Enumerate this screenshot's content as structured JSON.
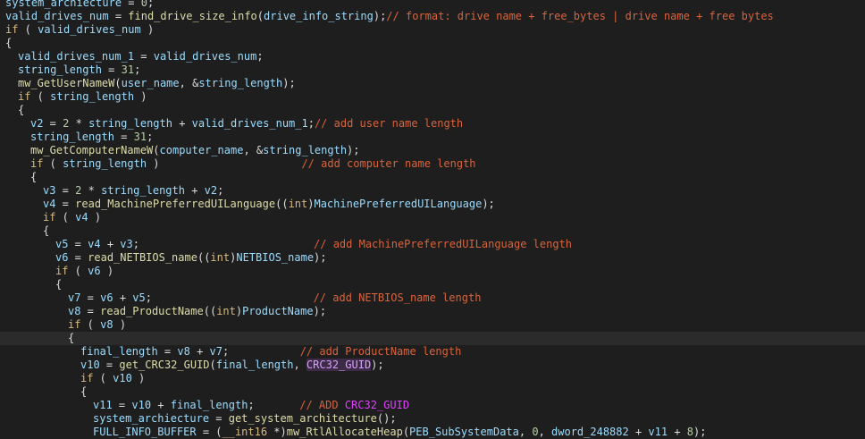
{
  "editor": {
    "colors": {
      "background": "#1e1e1e",
      "identifier": "#9cdcfe",
      "function": "#dcdcaa",
      "keyword": "#d7ba7d",
      "comment": "#d8643c",
      "highlight_symbol": "#d7a0ff",
      "highlight_background": "#3d2a46",
      "current_line": "#2b2b2b"
    },
    "lines": [
      {
        "indent": 0,
        "tokens": [
          [
            "ident",
            "system_archiecture"
          ],
          [
            "punct",
            " = "
          ],
          [
            "num",
            "0"
          ],
          [
            "punct",
            ";"
          ]
        ]
      },
      {
        "indent": 0,
        "tokens": [
          [
            "ident",
            "valid_drives_num"
          ],
          [
            "punct",
            " = "
          ],
          [
            "func",
            "find_drive_size_info"
          ],
          [
            "punct",
            "("
          ],
          [
            "ident",
            "drive_info_string"
          ],
          [
            "punct",
            ");"
          ],
          [
            "comment",
            "// format: drive name + free_bytes | drive name + free bytes"
          ]
        ]
      },
      {
        "indent": 0,
        "tokens": [
          [
            "kw",
            "if"
          ],
          [
            "punct",
            " ( "
          ],
          [
            "ident",
            "valid_drives_num"
          ],
          [
            "punct",
            " )"
          ]
        ]
      },
      {
        "indent": 0,
        "tokens": [
          [
            "punct",
            "{"
          ]
        ]
      },
      {
        "indent": 2,
        "tokens": [
          [
            "ident",
            "valid_drives_num_1"
          ],
          [
            "punct",
            " = "
          ],
          [
            "ident",
            "valid_drives_num"
          ],
          [
            "punct",
            ";"
          ]
        ]
      },
      {
        "indent": 2,
        "tokens": [
          [
            "ident",
            "string_length"
          ],
          [
            "punct",
            " = "
          ],
          [
            "num",
            "31"
          ],
          [
            "punct",
            ";"
          ]
        ]
      },
      {
        "indent": 2,
        "tokens": [
          [
            "func",
            "mw_GetUserNameW"
          ],
          [
            "punct",
            "("
          ],
          [
            "ident",
            "user_name"
          ],
          [
            "punct",
            ", &"
          ],
          [
            "ident",
            "string_length"
          ],
          [
            "punct",
            ");"
          ]
        ]
      },
      {
        "indent": 2,
        "tokens": [
          [
            "kw",
            "if"
          ],
          [
            "punct",
            " ( "
          ],
          [
            "ident",
            "string_length"
          ],
          [
            "punct",
            " )"
          ]
        ]
      },
      {
        "indent": 2,
        "tokens": [
          [
            "punct",
            "{"
          ]
        ]
      },
      {
        "indent": 4,
        "tokens": [
          [
            "ident",
            "v2"
          ],
          [
            "punct",
            " = "
          ],
          [
            "num",
            "2"
          ],
          [
            "punct",
            " * "
          ],
          [
            "ident",
            "string_length"
          ],
          [
            "punct",
            " + "
          ],
          [
            "ident",
            "valid_drives_num_1"
          ],
          [
            "punct",
            ";"
          ],
          [
            "comment",
            "// add user name length"
          ]
        ]
      },
      {
        "indent": 4,
        "tokens": [
          [
            "ident",
            "string_length"
          ],
          [
            "punct",
            " = "
          ],
          [
            "num",
            "31"
          ],
          [
            "punct",
            ";"
          ]
        ]
      },
      {
        "indent": 4,
        "tokens": [
          [
            "func",
            "mw_GetComputerNameW"
          ],
          [
            "punct",
            "("
          ],
          [
            "ident",
            "computer_name"
          ],
          [
            "punct",
            ", &"
          ],
          [
            "ident",
            "string_length"
          ],
          [
            "punct",
            ");"
          ]
        ]
      },
      {
        "indent": 4,
        "tokens": [
          [
            "kw",
            "if"
          ],
          [
            "punct",
            " ( "
          ],
          [
            "ident",
            "string_length"
          ],
          [
            "punct",
            " )                      "
          ],
          [
            "comment",
            "// add computer name length"
          ]
        ]
      },
      {
        "indent": 4,
        "tokens": [
          [
            "punct",
            "{"
          ]
        ]
      },
      {
        "indent": 6,
        "tokens": [
          [
            "ident",
            "v3"
          ],
          [
            "punct",
            " = "
          ],
          [
            "num",
            "2"
          ],
          [
            "punct",
            " * "
          ],
          [
            "ident",
            "string_length"
          ],
          [
            "punct",
            " + "
          ],
          [
            "ident",
            "v2"
          ],
          [
            "punct",
            ";"
          ]
        ]
      },
      {
        "indent": 6,
        "tokens": [
          [
            "ident",
            "v4"
          ],
          [
            "punct",
            " = "
          ],
          [
            "func",
            "read_MachinePreferredUILanguage"
          ],
          [
            "punct",
            "(("
          ],
          [
            "kw",
            "int"
          ],
          [
            "punct",
            ")"
          ],
          [
            "ident",
            "MachinePreferredUILanguage"
          ],
          [
            "punct",
            ");"
          ]
        ]
      },
      {
        "indent": 6,
        "tokens": [
          [
            "kw",
            "if"
          ],
          [
            "punct",
            " ( "
          ],
          [
            "ident",
            "v4"
          ],
          [
            "punct",
            " )"
          ]
        ]
      },
      {
        "indent": 6,
        "tokens": [
          [
            "punct",
            "{"
          ]
        ]
      },
      {
        "indent": 8,
        "tokens": [
          [
            "ident",
            "v5"
          ],
          [
            "punct",
            " = "
          ],
          [
            "ident",
            "v4"
          ],
          [
            "punct",
            " + "
          ],
          [
            "ident",
            "v3"
          ],
          [
            "punct",
            ";                           "
          ],
          [
            "comment",
            "// add MachinePreferredUILanguage length"
          ]
        ]
      },
      {
        "indent": 8,
        "tokens": [
          [
            "ident",
            "v6"
          ],
          [
            "punct",
            " = "
          ],
          [
            "func",
            "read_NETBIOS_name"
          ],
          [
            "punct",
            "(("
          ],
          [
            "kw",
            "int"
          ],
          [
            "punct",
            ")"
          ],
          [
            "ident",
            "NETBIOS_name"
          ],
          [
            "punct",
            ");"
          ]
        ]
      },
      {
        "indent": 8,
        "tokens": [
          [
            "kw",
            "if"
          ],
          [
            "punct",
            " ( "
          ],
          [
            "ident",
            "v6"
          ],
          [
            "punct",
            " )"
          ]
        ]
      },
      {
        "indent": 8,
        "tokens": [
          [
            "punct",
            "{"
          ]
        ]
      },
      {
        "indent": 10,
        "tokens": [
          [
            "ident",
            "v7"
          ],
          [
            "punct",
            " = "
          ],
          [
            "ident",
            "v6"
          ],
          [
            "punct",
            " + "
          ],
          [
            "ident",
            "v5"
          ],
          [
            "punct",
            ";                         "
          ],
          [
            "comment",
            "// add NETBIOS_name length"
          ]
        ]
      },
      {
        "indent": 10,
        "tokens": [
          [
            "ident",
            "v8"
          ],
          [
            "punct",
            " = "
          ],
          [
            "func",
            "read_ProductName"
          ],
          [
            "punct",
            "(("
          ],
          [
            "kw",
            "int"
          ],
          [
            "punct",
            ")"
          ],
          [
            "ident",
            "ProductName"
          ],
          [
            "punct",
            ");"
          ]
        ]
      },
      {
        "indent": 10,
        "tokens": [
          [
            "kw",
            "if"
          ],
          [
            "punct",
            " ( "
          ],
          [
            "ident",
            "v8"
          ],
          [
            "punct",
            " )"
          ]
        ]
      },
      {
        "indent": 10,
        "highlight": true,
        "tokens": [
          [
            "punct",
            "{"
          ]
        ]
      },
      {
        "indent": 12,
        "tokens": [
          [
            "ident",
            "final_length"
          ],
          [
            "punct",
            " = "
          ],
          [
            "ident",
            "v8"
          ],
          [
            "punct",
            " + "
          ],
          [
            "ident",
            "v7"
          ],
          [
            "punct",
            ";           "
          ],
          [
            "comment",
            "// add ProductName length"
          ]
        ]
      },
      {
        "indent": 12,
        "tokens": [
          [
            "ident",
            "v10"
          ],
          [
            "punct",
            " = "
          ],
          [
            "func",
            "get_CRC32_GUID"
          ],
          [
            "punct",
            "("
          ],
          [
            "ident",
            "final_length"
          ],
          [
            "punct",
            ", "
          ],
          [
            "hl",
            "CRC32_GUID"
          ],
          [
            "punct",
            ");"
          ]
        ]
      },
      {
        "indent": 12,
        "tokens": [
          [
            "kw",
            "if"
          ],
          [
            "punct",
            " ( "
          ],
          [
            "ident",
            "v10"
          ],
          [
            "punct",
            " )"
          ]
        ]
      },
      {
        "indent": 12,
        "tokens": [
          [
            "punct",
            "{"
          ]
        ]
      },
      {
        "indent": 14,
        "tokens": [
          [
            "ident",
            "v11"
          ],
          [
            "punct",
            " = "
          ],
          [
            "ident",
            "v10"
          ],
          [
            "punct",
            " + "
          ],
          [
            "ident",
            "final_length"
          ],
          [
            "punct",
            ";       "
          ],
          [
            "comment",
            "// ADD "
          ],
          [
            "commenthl",
            "CRC32_GUID"
          ]
        ]
      },
      {
        "indent": 14,
        "tokens": [
          [
            "ident",
            "system_archiecture"
          ],
          [
            "punct",
            " = "
          ],
          [
            "func",
            "get_system_architecture"
          ],
          [
            "punct",
            "();"
          ]
        ]
      },
      {
        "indent": 14,
        "tokens": [
          [
            "ident",
            "FULL_INFO_BUFFER"
          ],
          [
            "punct",
            " = ("
          ],
          [
            "kw",
            "__int16"
          ],
          [
            "punct",
            " *)"
          ],
          [
            "func",
            "mw_RtlAllocateHeap"
          ],
          [
            "punct",
            "("
          ],
          [
            "ident",
            "PEB_SubSystemData"
          ],
          [
            "punct",
            ", "
          ],
          [
            "num",
            "0"
          ],
          [
            "punct",
            ", "
          ],
          [
            "ident",
            "dword_248882"
          ],
          [
            "punct",
            " + "
          ],
          [
            "ident",
            "v11"
          ],
          [
            "punct",
            " + "
          ],
          [
            "num",
            "8"
          ],
          [
            "punct",
            ");"
          ]
        ]
      }
    ]
  }
}
